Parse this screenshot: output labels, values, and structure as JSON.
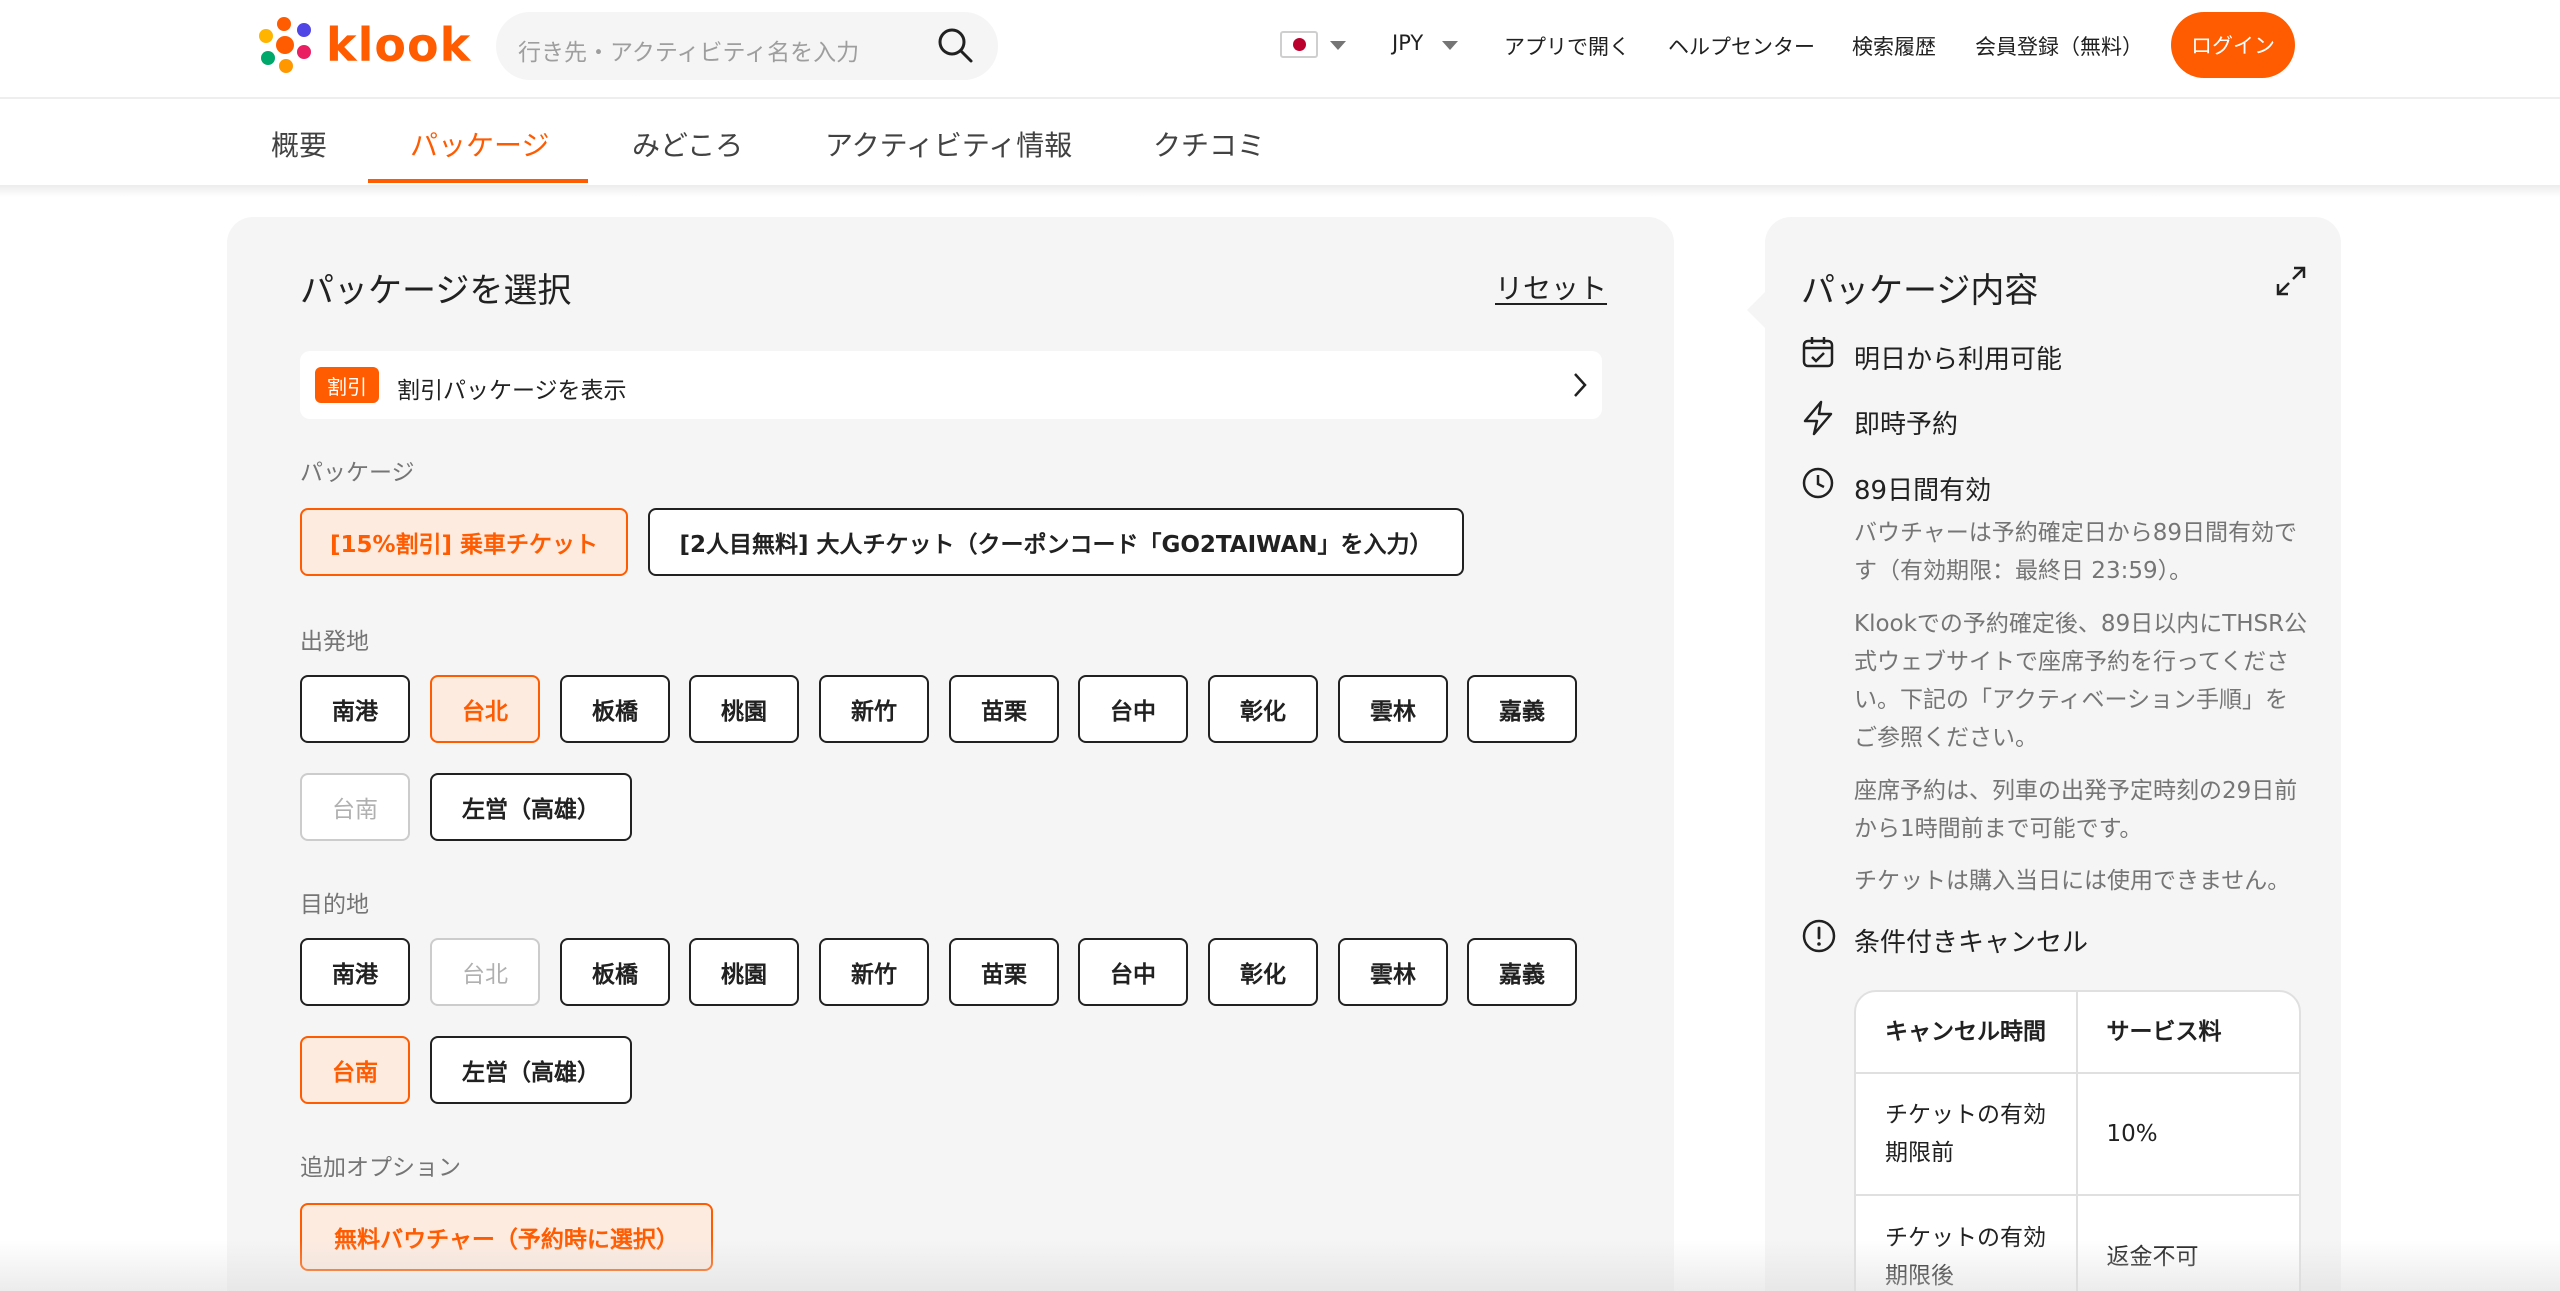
{
  "header": {
    "logo_text": "klook",
    "search_placeholder": "行き先・アクティビティ名を入力",
    "currency": "JPY",
    "open_app": "アプリで開く",
    "help_center": "ヘルプセンター",
    "search_history": "検索履歴",
    "signup": "会員登録（無料）",
    "login": "ログイン",
    "accent_color": "#ff5b00"
  },
  "tabs": [
    {
      "label": "概要",
      "active": false
    },
    {
      "label": "パッケージ",
      "active": true
    },
    {
      "label": "みどころ",
      "active": false
    },
    {
      "label": "アクティビティ情報",
      "active": false
    },
    {
      "label": "クチコミ",
      "active": false
    }
  ],
  "package_panel": {
    "title": "パッケージを選択",
    "reset": "リセット",
    "discount_badge": "割引",
    "discount_label": "割引パッケージを表示",
    "package_label": "パッケージ",
    "packages": [
      {
        "label": "[15%割引] 乗車チケット",
        "state": "selected"
      },
      {
        "label": "[2人目無料] 大人チケット（クーポンコード「GO2TAIWAN」を入力）",
        "state": "normal"
      }
    ],
    "departure_label": "出発地",
    "departures": [
      {
        "label": "南港",
        "state": "normal"
      },
      {
        "label": "台北",
        "state": "selected"
      },
      {
        "label": "板橋",
        "state": "normal"
      },
      {
        "label": "桃園",
        "state": "normal"
      },
      {
        "label": "新竹",
        "state": "normal"
      },
      {
        "label": "苗栗",
        "state": "normal"
      },
      {
        "label": "台中",
        "state": "normal"
      },
      {
        "label": "彰化",
        "state": "normal"
      },
      {
        "label": "雲林",
        "state": "normal"
      },
      {
        "label": "嘉義",
        "state": "normal"
      },
      {
        "label": "台南",
        "state": "disabled"
      },
      {
        "label": "左営（高雄）",
        "state": "normal"
      }
    ],
    "destination_label": "目的地",
    "destinations": [
      {
        "label": "南港",
        "state": "normal"
      },
      {
        "label": "台北",
        "state": "disabled"
      },
      {
        "label": "板橋",
        "state": "normal"
      },
      {
        "label": "桃園",
        "state": "normal"
      },
      {
        "label": "新竹",
        "state": "normal"
      },
      {
        "label": "苗栗",
        "state": "normal"
      },
      {
        "label": "台中",
        "state": "normal"
      },
      {
        "label": "彰化",
        "state": "normal"
      },
      {
        "label": "雲林",
        "state": "normal"
      },
      {
        "label": "嘉義",
        "state": "normal"
      },
      {
        "label": "台南",
        "state": "selected"
      },
      {
        "label": "左営（高雄）",
        "state": "normal"
      }
    ],
    "option_label": "追加オプション",
    "options": [
      {
        "label": "無料バウチャー（予約時に選択）",
        "state": "selected"
      }
    ]
  },
  "details_panel": {
    "title": "パッケージ内容",
    "available": "明日から利用可能",
    "instant": "即時予約",
    "validity": "89日間有効",
    "para1": "バウチャーは予約確定日から89日間有効です（有効期限：最終日 23:59）。",
    "para2": "Klookでの予約確定後、89日以内にTHSR公式ウェブサイトで座席予約を行ってください。下記の「アクティベーション手順」をご参照ください。",
    "para3": "座席予約は、列車の出発予定時刻の29日前から1時間前まで可能です。",
    "para4": "チケットは購入当日には使用できません。",
    "cancel_title": "条件付きキャンセル",
    "cancel_table": {
      "headers": [
        "キャンセル時間",
        "サービス料"
      ],
      "rows": [
        [
          "チケットの有効期限前",
          "10%"
        ],
        [
          "チケットの有効期限後",
          "返金不可"
        ]
      ]
    }
  }
}
